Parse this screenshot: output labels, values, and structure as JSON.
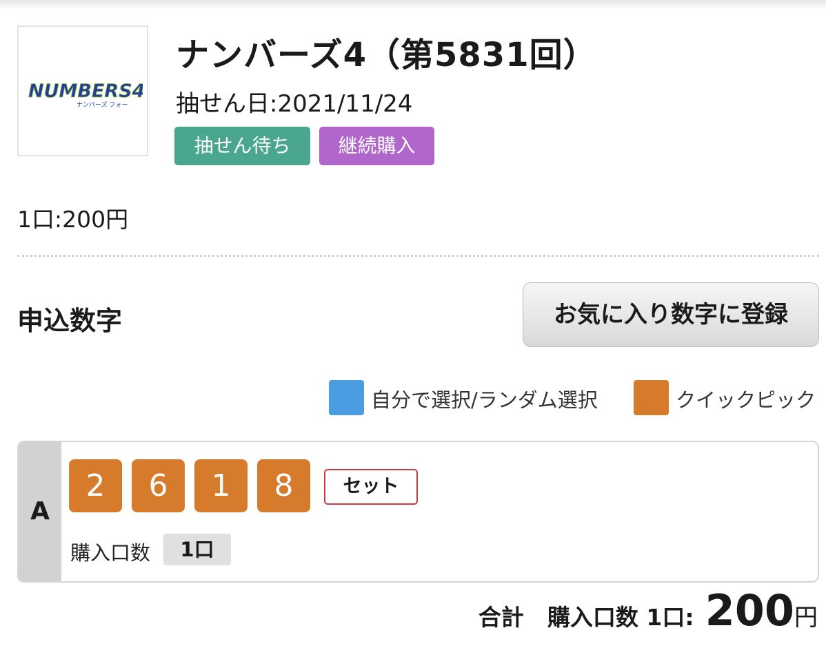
{
  "header": {
    "logo_text": "NUMBERS4",
    "logo_subtext": "ナンバーズ フォー",
    "title": "ナンバーズ4（第5831回）",
    "draw_date": "抽せん日:2021/11/24",
    "badges": [
      {
        "label": "抽せん待ち",
        "color": "#4aa68f"
      },
      {
        "label": "継続購入",
        "color": "#b166cc"
      }
    ]
  },
  "price": "1口:200円",
  "section": {
    "title": "申込数字",
    "favorite_button": "お気に入り数字に登録"
  },
  "legend": [
    {
      "label": "自分で選択/ランダム選択",
      "color": "#4a9de0"
    },
    {
      "label": "クイックピック",
      "color": "#d67a2c"
    }
  ],
  "entry": {
    "letter": "A",
    "digits": [
      "2",
      "6",
      "1",
      "8"
    ],
    "set_button": "セット",
    "quantity_label": "購入口数",
    "quantity_value": "1口"
  },
  "total": {
    "label": "合計",
    "quantity": "購入口数 1口:",
    "amount": "200",
    "unit": "円"
  }
}
